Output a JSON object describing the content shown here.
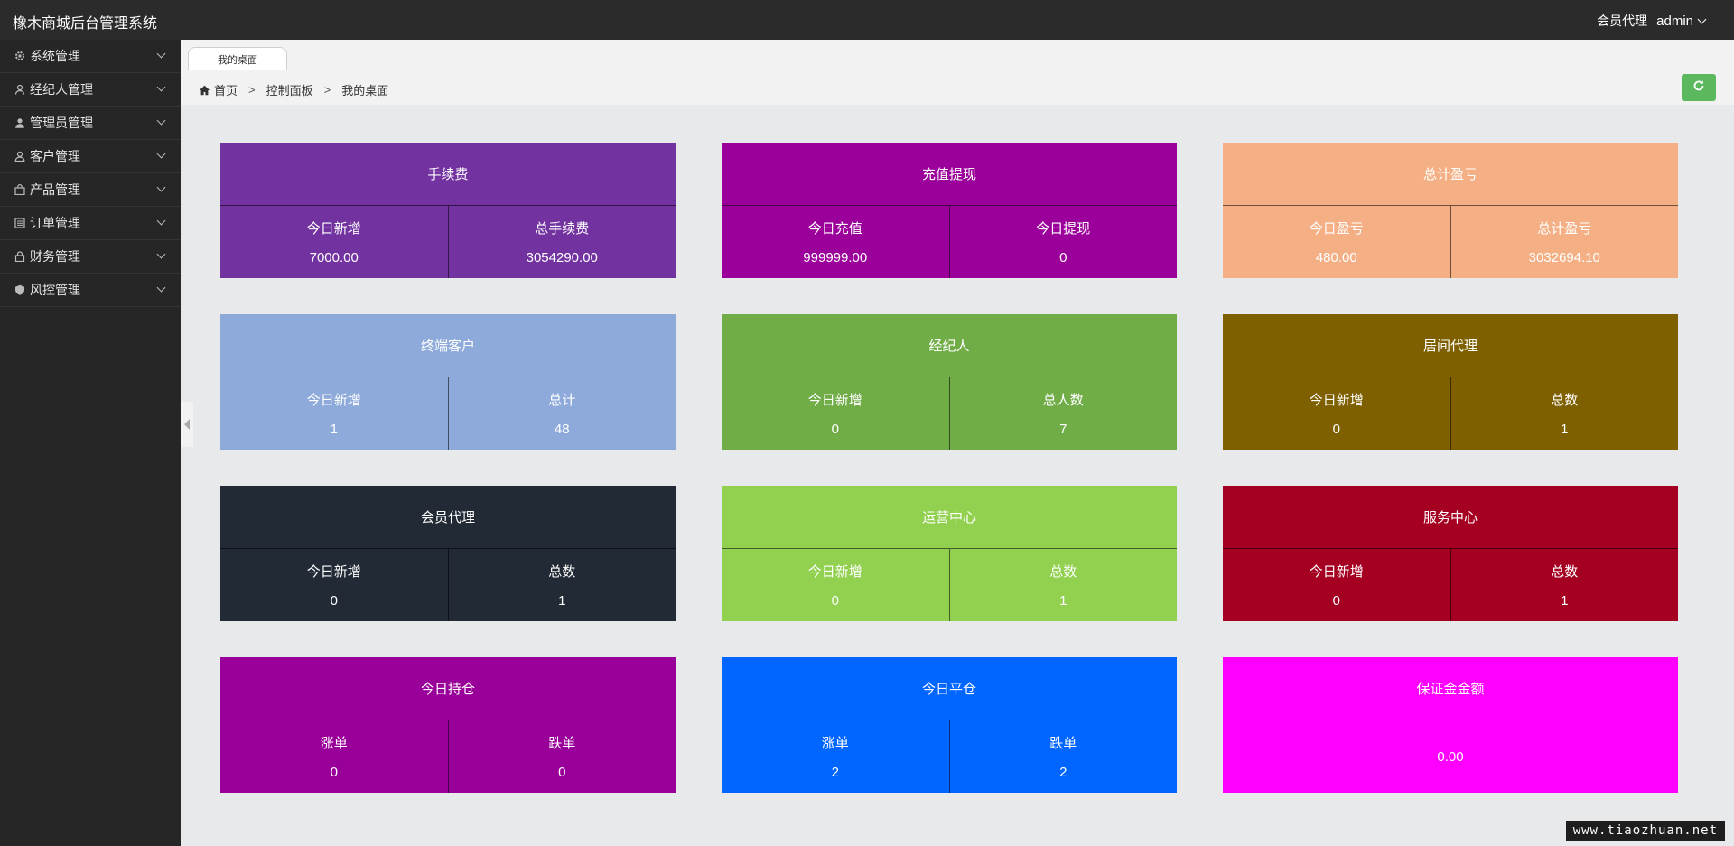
{
  "app": {
    "title": "橡木商城后台管理系统"
  },
  "header": {
    "role": "会员代理",
    "user": "admin"
  },
  "sidebar": {
    "items": [
      {
        "label": "系统管理",
        "icon": "gear-icon"
      },
      {
        "label": "经纪人管理",
        "icon": "broker-icon"
      },
      {
        "label": "管理员管理",
        "icon": "admin-user-icon"
      },
      {
        "label": "客户管理",
        "icon": "customer-icon"
      },
      {
        "label": "产品管理",
        "icon": "product-bag-icon"
      },
      {
        "label": "订单管理",
        "icon": "order-list-icon"
      },
      {
        "label": "财务管理",
        "icon": "lock-icon"
      },
      {
        "label": "风控管理",
        "icon": "shield-icon"
      }
    ]
  },
  "tabs": [
    {
      "label": "我的桌面"
    }
  ],
  "breadcrumb": {
    "items": [
      "首页",
      "控制面板",
      "我的桌面"
    ],
    "separator": ">"
  },
  "cards": [
    {
      "title": "手续费",
      "color": "#7232a0",
      "cells": [
        {
          "label": "今日新增",
          "value": "7000.00"
        },
        {
          "label": "总手续费",
          "value": "3054290.00"
        }
      ]
    },
    {
      "title": "充值提现",
      "color": "#9b009b",
      "cells": [
        {
          "label": "今日充值",
          "value": "999999.00"
        },
        {
          "label": "今日提现",
          "value": "0"
        }
      ]
    },
    {
      "title": "总计盈亏",
      "color": "#f4b084",
      "cells": [
        {
          "label": "今日盈亏",
          "value": "480.00"
        },
        {
          "label": "总计盈亏",
          "value": "3032694.10"
        }
      ]
    },
    {
      "title": "终端客户",
      "color": "#8eaadb",
      "cells": [
        {
          "label": "今日新增",
          "value": "1"
        },
        {
          "label": "总计",
          "value": "48"
        }
      ]
    },
    {
      "title": "经纪人",
      "color": "#70ad47",
      "cells": [
        {
          "label": "今日新增",
          "value": "0"
        },
        {
          "label": "总人数",
          "value": "7"
        }
      ]
    },
    {
      "title": "居间代理",
      "color": "#7f6000",
      "cells": [
        {
          "label": "今日新增",
          "value": "0"
        },
        {
          "label": "总数",
          "value": "1"
        }
      ]
    },
    {
      "title": "会员代理",
      "color": "#222a35",
      "cells": [
        {
          "label": "今日新增",
          "value": "0"
        },
        {
          "label": "总数",
          "value": "1"
        }
      ]
    },
    {
      "title": "运营中心",
      "color": "#92d050",
      "cells": [
        {
          "label": "今日新增",
          "value": "0"
        },
        {
          "label": "总数",
          "value": "1"
        }
      ]
    },
    {
      "title": "服务中心",
      "color": "#a50021",
      "cells": [
        {
          "label": "今日新增",
          "value": "0"
        },
        {
          "label": "总数",
          "value": "1"
        }
      ]
    },
    {
      "title": "今日持仓",
      "color": "#990099",
      "cells": [
        {
          "label": "涨单",
          "value": "0"
        },
        {
          "label": "跌单",
          "value": "0"
        }
      ]
    },
    {
      "title": "今日平仓",
      "color": "#0066ff",
      "cells": [
        {
          "label": "涨单",
          "value": "2"
        },
        {
          "label": "跌单",
          "value": "2"
        }
      ]
    },
    {
      "title": "保证金金额",
      "color": "#ff00ff",
      "cells": [
        {
          "label": "",
          "value": "0.00"
        }
      ]
    }
  ],
  "watermark": "www.tiaozhuan.net"
}
